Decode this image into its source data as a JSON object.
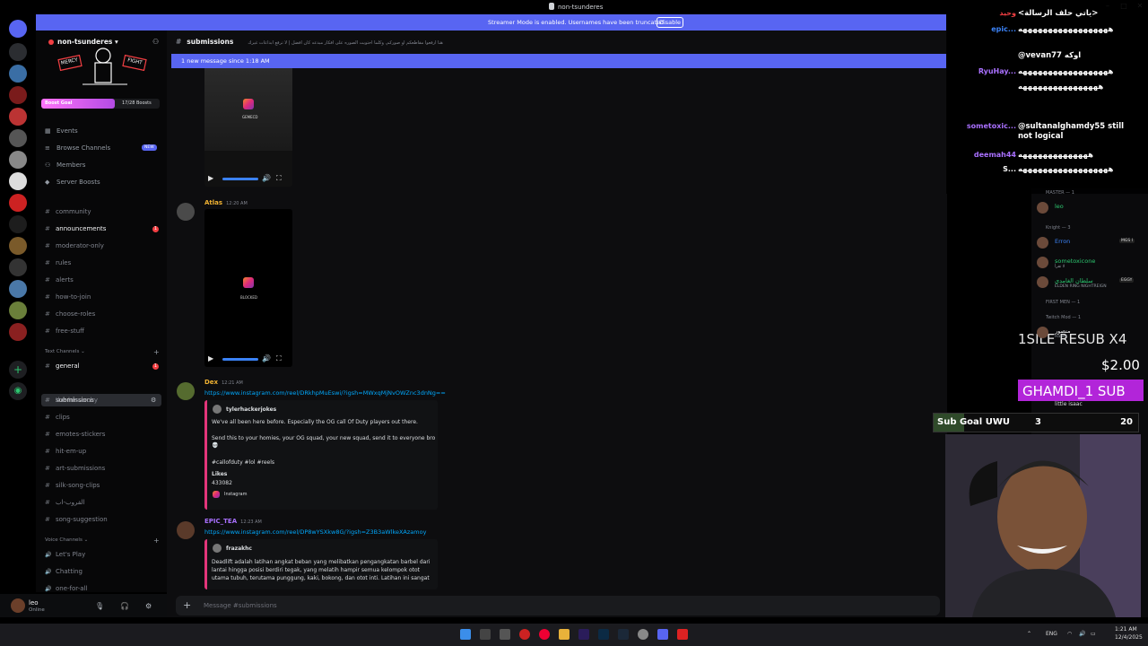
{
  "window": {
    "title": "non-tsunderes"
  },
  "banner": {
    "text": "Streamer Mode is enabled. Usernames have been truncated.",
    "button": "Disable"
  },
  "guild": {
    "name": "non-tsunderes",
    "boost_label": "Boost Goal",
    "boost_count": "17/28 Boosts",
    "banner_text_left": "MERCY",
    "banner_text_right": "FIGHT"
  },
  "nav": [
    {
      "label": "Events",
      "icon": "calendar-icon"
    },
    {
      "label": "Browse Channels",
      "icon": "browse-icon",
      "tag": "NEW"
    },
    {
      "label": "Members",
      "icon": "members-icon"
    },
    {
      "label": "Server Boosts",
      "icon": "boost-icon"
    }
  ],
  "channels_top": [
    {
      "name": "community",
      "bright": false
    },
    {
      "name": "announcements",
      "bright": true,
      "badge": "1"
    },
    {
      "name": "moderator-only",
      "bright": false
    },
    {
      "name": "rules",
      "bright": false
    },
    {
      "name": "alerts",
      "bright": false
    },
    {
      "name": "how-to-join",
      "bright": false
    },
    {
      "name": "choose-roles",
      "bright": false
    },
    {
      "name": "free-stuff",
      "bright": false
    }
  ],
  "text_category": "Text Channels",
  "text_channels": [
    {
      "name": "general",
      "bright": true,
      "badge": "1"
    },
    {
      "name": "submissions",
      "bright": true,
      "active": true
    },
    {
      "name": "the-hierarchy",
      "bright": false
    },
    {
      "name": "clips",
      "bright": false
    },
    {
      "name": "emotes-stickers",
      "bright": false
    },
    {
      "name": "hit-em-up",
      "bright": false
    },
    {
      "name": "art-submissions",
      "bright": false
    },
    {
      "name": "silk-song-clips",
      "bright": false
    },
    {
      "name": "القروب-اب",
      "bright": false
    },
    {
      "name": "song-suggestion",
      "bright": false
    }
  ],
  "voice_category": "Voice Channels",
  "voice_channels": [
    "Let's Play",
    "Chatting",
    "one-for-all"
  ],
  "user": {
    "name": "leo",
    "status": "Online"
  },
  "chat": {
    "channel": "submissions",
    "topic": "هنا ارفعوا مقاطعكم او صوركم, وكلما احتويت الصوره على افكار مبدعه كان افضل | لا ترفع ابداعات غيرك",
    "new_messages": "1 new message since 1:18 AM",
    "composer_placeholder": "Message #submissions",
    "video1_label": "GEMECD",
    "messages": [
      {
        "author": "Atlas",
        "time": "12:20 AM",
        "color": "#f0b232",
        "video_label": "BLOCKED"
      },
      {
        "author": "Dex",
        "time": "12:21 AM",
        "color": "#f0b232",
        "link": "https://www.instagram.com/reel/DRkhpMuEswi/?igsh=MWxqMjNvOWZnc3dnNg==",
        "embed": {
          "author": "tylerhackerjokes",
          "body": "We've all been here before. Especially the OG call Of Duty players out there.",
          "body2": "Send this to your homies, your OG squad, your new squad, send it to everyone bro",
          "emoji": "💀",
          "tags": "#callofduty #lol #reels",
          "likes_label": "Likes",
          "likes": "433082",
          "footer": "Instagram"
        }
      },
      {
        "author": "EPIC_TEA",
        "time": "12:23 AM",
        "color": "#a970ff",
        "link": "https://www.instagram.com/reel/DP8wYSXkw8G/?igsh=Z3B3aWlkeXAzamoy",
        "embed": {
          "author": "frazakhc",
          "body": "Deadlift adalah latihan angkat beban yang melibatkan pengangkatan barbel dari lantai hingga posisi berdiri tegak, yang melatih hampir semua kelompok otot utama tubuh, terutama punggung, kaki, bokong, dan otot inti. Latihan ini sangat"
        }
      }
    ]
  },
  "members": {
    "categories": [
      {
        "label": "MASTER — 1",
        "items": [
          {
            "name": "leo",
            "color": "#2dc770"
          }
        ]
      },
      {
        "label": "Knight — 3",
        "items": [
          {
            "name": "Erron",
            "color": "#3b82f6",
            "tag": "MGS I"
          },
          {
            "name": "sometoxicone",
            "color": "#2dc770",
            "sub": "لا تقرأ"
          },
          {
            "name": "سلطان الغامدي",
            "color": "#2dc770",
            "tag": "EGGY",
            "sub": "ELDEN RING NIGHTREIGN"
          }
        ]
      },
      {
        "label": "FIRST MEN — 1",
        "items": []
      },
      {
        "label": "Twitch Mod — 1",
        "items": [
          {
            "name": "منصور",
            "color": "#f2f3f5",
            "sub": "Hades"
          }
        ]
      }
    ],
    "last_item": "little isaac"
  },
  "stream_chat": {
    "lines": [
      {
        "name": "وحيد",
        "color": "#f23f43",
        "msg": "&lt;ياتي حلف الرسالة&gt;"
      },
      {
        "name": "epic...",
        "color": "#3b82f6",
        "msg": "ههههههههههههههههههه"
      },
      {
        "name": "",
        "color": "#fff",
        "msg": "@vevan77 اوكه"
      },
      {
        "name": "RyuHay...",
        "color": "#a970ff",
        "msg": "ههههههههههههههههههه"
      },
      {
        "name": "",
        "color": "#fff",
        "msg": "ههههههههههههههههه"
      },
      {
        "name": "sometoxic...",
        "color": "#a970ff",
        "msg": "@sultanalghamdy55 still not logical"
      },
      {
        "name": "deemah44",
        "color": "#a970ff",
        "msg": "ههههههههههههههه"
      },
      {
        "name": "S...",
        "color": "#fff",
        "msg": "ههههههههههههههههههه"
      }
    ]
  },
  "alerts": {
    "resub": "1SILE  RESUB X4",
    "amount": "$2.00",
    "sub": "GHAMDI_1  SUB"
  },
  "sub_goal": {
    "label": "Sub Goal UWU",
    "current": "3",
    "target": "20",
    "progress": 0.15
  },
  "taskbar": {
    "lang": "ENG",
    "time": "1:21 AM",
    "date": "12/4/2025"
  },
  "colors": {
    "blurple": "#5865f2",
    "bg": "#0d0d0f",
    "sidebar": "#070708"
  }
}
